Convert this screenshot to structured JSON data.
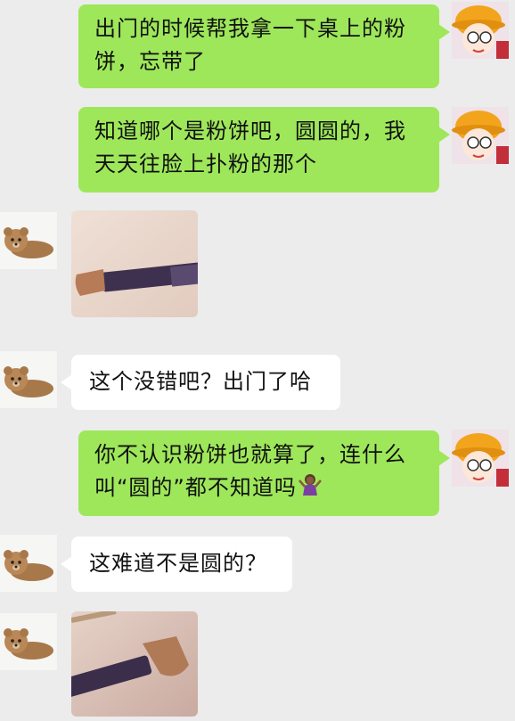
{
  "messages": [
    {
      "side": "self",
      "type": "text",
      "text": "出门的时候帮我拿一下桌上的粉饼，忘带了"
    },
    {
      "side": "self",
      "type": "text",
      "text": "知道哪个是粉饼吧，圆圆的，我天天往脸上扑粉的那个"
    },
    {
      "side": "other",
      "type": "image",
      "icon": "makeup-brush-photo"
    },
    {
      "side": "other",
      "type": "text",
      "text": "这个没错吧？出门了哈"
    },
    {
      "side": "self",
      "type": "text",
      "text": "你不认识粉饼也就算了，连什么叫“圆的”都不知道吗",
      "emoji": "shrugging-woman-emoji"
    },
    {
      "side": "other",
      "type": "text",
      "text": "这难道不是圆的？"
    },
    {
      "side": "other",
      "type": "image",
      "icon": "makeup-brush-photo"
    }
  ],
  "avatars": {
    "self": "cartoon-girl-yellow-hat-icon",
    "other": "teddy-bear-icon"
  }
}
